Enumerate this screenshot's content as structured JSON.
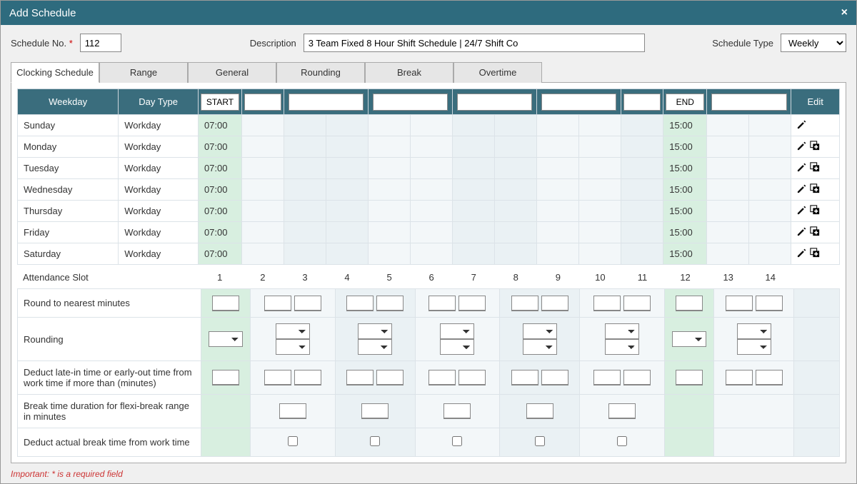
{
  "dialog": {
    "title": "Add Schedule"
  },
  "form": {
    "schedule_no_label": "Schedule No.",
    "schedule_no_value": "112",
    "description_label": "Description",
    "description_value": "3 Team Fixed 8 Hour Shift Schedule | 24/7 Shift Co",
    "schedule_type_label": "Schedule Type",
    "schedule_type_value": "Weekly"
  },
  "tabs": {
    "clocking": "Clocking Schedule",
    "range": "Range",
    "general": "General",
    "rounding": "Rounding",
    "break": "Break",
    "overtime": "Overtime"
  },
  "headers": {
    "weekday": "Weekday",
    "daytype": "Day Type",
    "start": "START",
    "end": "END",
    "edit": "Edit"
  },
  "rows": [
    {
      "day": "Sunday",
      "type": "Workday",
      "start": "07:00",
      "end": "15:00",
      "add": false
    },
    {
      "day": "Monday",
      "type": "Workday",
      "start": "07:00",
      "end": "15:00",
      "add": true
    },
    {
      "day": "Tuesday",
      "type": "Workday",
      "start": "07:00",
      "end": "15:00",
      "add": true
    },
    {
      "day": "Wednesday",
      "type": "Workday",
      "start": "07:00",
      "end": "15:00",
      "add": true
    },
    {
      "day": "Thursday",
      "type": "Workday",
      "start": "07:00",
      "end": "15:00",
      "add": true
    },
    {
      "day": "Friday",
      "type": "Workday",
      "start": "07:00",
      "end": "15:00",
      "add": true
    },
    {
      "day": "Saturday",
      "type": "Workday",
      "start": "07:00",
      "end": "15:00",
      "add": true
    }
  ],
  "attendance_slot_label": "Attendance Slot",
  "slots": [
    "1",
    "2",
    "3",
    "4",
    "5",
    "6",
    "7",
    "8",
    "9",
    "10",
    "11",
    "12",
    "13",
    "14"
  ],
  "config": {
    "round_minutes": "Round to nearest minutes",
    "rounding": "Rounding",
    "deduct_late": "Deduct late-in time or early-out time from work time if more than (minutes)",
    "break_duration": "Break time duration for flexi-break range in minutes",
    "deduct_actual": "Deduct actual break time from work time"
  },
  "footnote": "Important: * is a required field"
}
